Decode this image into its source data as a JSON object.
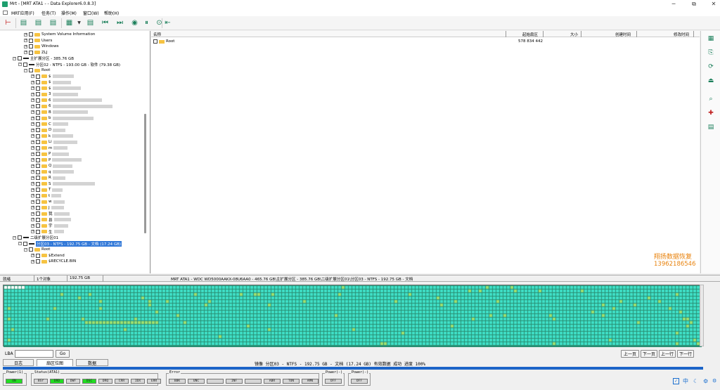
{
  "window": {
    "title": "Mrt - [MRT ATA1 -  - Data Explorer6.0.8.3]",
    "minimize": "─",
    "restore": "⧉",
    "close": "✕"
  },
  "menu": [
    "MRT应用(F)",
    "任务(T)",
    "操作(M)",
    "窗口(W)",
    "帮助(H)"
  ],
  "toolbar_icons": [
    "disk-icon",
    "scan-icon",
    "search-icon",
    "list-icon",
    "doc-icon",
    "dropdown-arrow-icon",
    "report-icon",
    "skip-back-icon",
    "skip-fwd-icon",
    "stop-icon",
    "pause-icon",
    "play-icon",
    "exit-icon"
  ],
  "tree": {
    "items": [
      {
        "label": "System Volume Information",
        "level": 3,
        "type": "folder"
      },
      {
        "label": "Users",
        "level": 3,
        "type": "folder"
      },
      {
        "label": "Windows",
        "level": 3,
        "type": "folder"
      },
      {
        "label": "ZLJ",
        "level": 3,
        "type": "folder"
      },
      {
        "label": "主扩展分区 - 385.76 GB",
        "level": 1,
        "type": "drive"
      },
      {
        "label": "分区02 - NTFS - 193.00 GB - 软件 (79.38 GB)",
        "level": 2,
        "type": "drive"
      },
      {
        "label": "Root",
        "level": 3,
        "type": "folder"
      },
      {
        "label": "$",
        "level": 4,
        "type": "folder",
        "blur": 30
      },
      {
        "label": "$",
        "level": 4,
        "type": "folder",
        "blur": 26
      },
      {
        "label": "$",
        "level": 4,
        "type": "folder",
        "blur": 40
      },
      {
        "label": "3",
        "level": 4,
        "type": "folder",
        "blur": 36
      },
      {
        "label": "6",
        "level": 4,
        "type": "folder",
        "blur": 70
      },
      {
        "label": "6",
        "level": 4,
        "type": "folder",
        "blur": 85
      },
      {
        "label": "B",
        "level": 4,
        "type": "folder",
        "blur": 50
      },
      {
        "label": "b",
        "level": 4,
        "type": "folder",
        "blur": 58
      },
      {
        "label": "C",
        "level": 4,
        "type": "folder",
        "blur": 22
      },
      {
        "label": "D",
        "level": 4,
        "type": "folder",
        "blur": 18
      },
      {
        "label": "k",
        "level": 4,
        "type": "folder",
        "blur": 30
      },
      {
        "label": "Li",
        "level": 4,
        "type": "folder",
        "blur": 34
      },
      {
        "label": "m",
        "level": 4,
        "type": "folder",
        "blur": 20
      },
      {
        "label": "P",
        "level": 4,
        "type": "folder",
        "blur": 24
      },
      {
        "label": "P",
        "level": 4,
        "type": "folder",
        "blur": 42
      },
      {
        "label": "Q",
        "level": 4,
        "type": "folder",
        "blur": 28
      },
      {
        "label": "q",
        "level": 4,
        "type": "folder",
        "blur": 30
      },
      {
        "label": "R",
        "level": 4,
        "type": "folder",
        "blur": 18
      },
      {
        "label": "S",
        "level": 4,
        "type": "folder",
        "blur": 60
      },
      {
        "label": "T",
        "level": 4,
        "type": "folder",
        "blur": 15
      },
      {
        "label": "t",
        "level": 4,
        "type": "folder",
        "blur": 14
      },
      {
        "label": "w",
        "level": 4,
        "type": "folder",
        "blur": 16
      },
      {
        "label": "J",
        "level": 4,
        "type": "folder",
        "blur": 18
      },
      {
        "label": "我",
        "level": 4,
        "type": "folder",
        "blur": 22
      },
      {
        "label": "县",
        "level": 4,
        "type": "folder",
        "blur": 24
      },
      {
        "label": "宇",
        "level": 4,
        "type": "folder",
        "blur": 20
      },
      {
        "label": "生",
        "level": 4,
        "type": "folder",
        "blur": 14
      },
      {
        "label": "二级扩展分区01",
        "level": 1,
        "type": "drive"
      },
      {
        "label": "分区03 - NTFS - 192.75 GB - 文档 (17.24 GB)",
        "level": 2,
        "type": "drive",
        "selected": true
      },
      {
        "label": "Root",
        "level": 3,
        "type": "folder"
      },
      {
        "label": "$Extend",
        "level": 4,
        "type": "folder"
      },
      {
        "label": "$RECYCLE.BIN",
        "level": 4,
        "type": "folder"
      }
    ]
  },
  "files": {
    "columns": [
      "名称",
      "起始扇区",
      "大小",
      "创建时间",
      "修改时间"
    ],
    "rows": [
      {
        "name": "Root",
        "start": "578 834 442",
        "size": "",
        "created": "",
        "modified": ""
      }
    ]
  },
  "sidebar_icons": [
    "qrcode-icon",
    "copy-icon",
    "refresh-icon",
    "upload-icon",
    "search-doc-icon",
    "recover-icon",
    "export-icon"
  ],
  "watermark": {
    "line1": "翔扬数据恢复",
    "line2": "13962186546"
  },
  "info": {
    "state": "就绪",
    "count": "1个对象",
    "size": "192.75 GB",
    "path": "MRT ATA1 - WDC WD5000AAKX-08U6AA0 - 465.76 GB\\主扩展分区 - 385.76 GB\\二级扩展分区01\\分区03 - NTFS - 192.75 GB - 文档"
  },
  "nav": {
    "lba_label": "LBA",
    "go": "Go",
    "prev_page": "上一页",
    "next_page": "下一页",
    "prev_row": "上一行",
    "next_row": "下一行"
  },
  "tabs": [
    "日志",
    "扇区位图",
    "数据"
  ],
  "status_line": "镜像 分区03 - NTFS - 192.75 GB - 文档 (17.24 GB) 有效数据 成功  进度 100%",
  "progress": 1.0,
  "hdd": {
    "power": {
      "label": "Power(1)",
      "leds": [
        {
          "t": "ON",
          "on": true
        }
      ]
    },
    "status": {
      "label": "Status(ATA1)",
      "leds": [
        {
          "t": "BSY",
          "on": false
        },
        {
          "t": "DRD",
          "on": true
        },
        {
          "t": "DWF",
          "on": false
        },
        {
          "t": "DSC",
          "on": true
        },
        {
          "t": "DRQ",
          "on": false
        },
        {
          "t": "CRR",
          "on": false
        },
        {
          "t": "IDX",
          "on": false
        },
        {
          "t": "ERR",
          "on": false
        }
      ]
    },
    "error": {
      "label": "Error",
      "leds": [
        {
          "t": "BBK",
          "on": false
        },
        {
          "t": "UNC",
          "on": false
        },
        {
          "t": "",
          "on": false
        },
        {
          "t": "INF",
          "on": false
        },
        {
          "t": "",
          "on": false
        },
        {
          "t": "ABR",
          "on": false
        },
        {
          "t": "TON",
          "on": false
        },
        {
          "t": "AMN",
          "on": false
        }
      ]
    },
    "power2": {
      "label": "Power(-)",
      "leds": [
        {
          "t": "OFF",
          "on": false
        }
      ]
    },
    "power3": {
      "label": "Power(-)",
      "leds": [
        {
          "t": "OFF",
          "on": false
        }
      ]
    }
  },
  "tray": {
    "lang": "中",
    "icons": [
      "checkbox-tray-icon",
      "moon-icon",
      "settings-icon"
    ]
  },
  "colors": {
    "map_bg": "#2a8f73",
    "block": "#3fe0c8",
    "block_used": "#9ee070",
    "selected": "#3178d8",
    "folder": "#f6c342",
    "progress": "#1c64c8"
  }
}
